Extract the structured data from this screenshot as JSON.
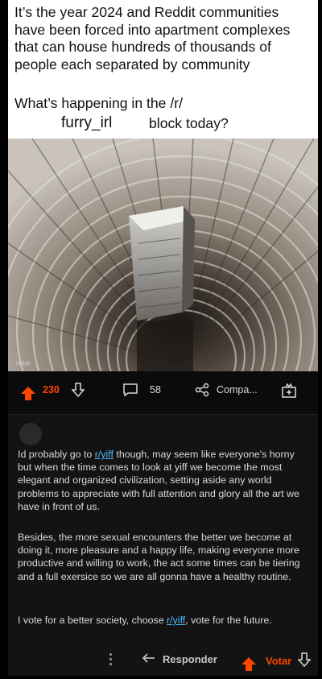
{
  "meme": {
    "line1": "It’s the year 2024 and Reddit communities",
    "line2": "have been forced into apartment complexes",
    "line3": "that can house hundreds of thousands of",
    "line4": "people each separated by community",
    "question": "What’s happening in the /r/",
    "subreddit": "furry_irl",
    "question_end": "block today?"
  },
  "post_actions": {
    "score": "230",
    "comments": "58",
    "share_label": "Compa..."
  },
  "comment": {
    "p1_pre": "Id probably go to ",
    "p1_link": "r/yiff",
    "p1_post": " though, may seem like everyone's horny but when the time comes to look at yiff we become the most elegant and organized civilization, setting aside any world problems to appreciate with full attention and glory all the art we have in front of us.",
    "p2": "Besides, the more sexual encounters the better we become at doing it, more pleasure and a happy life, making everyone more productive and willing to work, the act some times can be tiering and a full exersice so we are all gonna have a healthy routine.",
    "p3_pre": "I vote for a better society, choose ",
    "p3_link": "r/yiff",
    "p3_post": ", vote for the future.",
    "reply_label": "Responder",
    "vote_label": "Votar"
  },
  "colors": {
    "accent": "#ff4500",
    "link": "#4fbcff",
    "card": "#131313"
  }
}
